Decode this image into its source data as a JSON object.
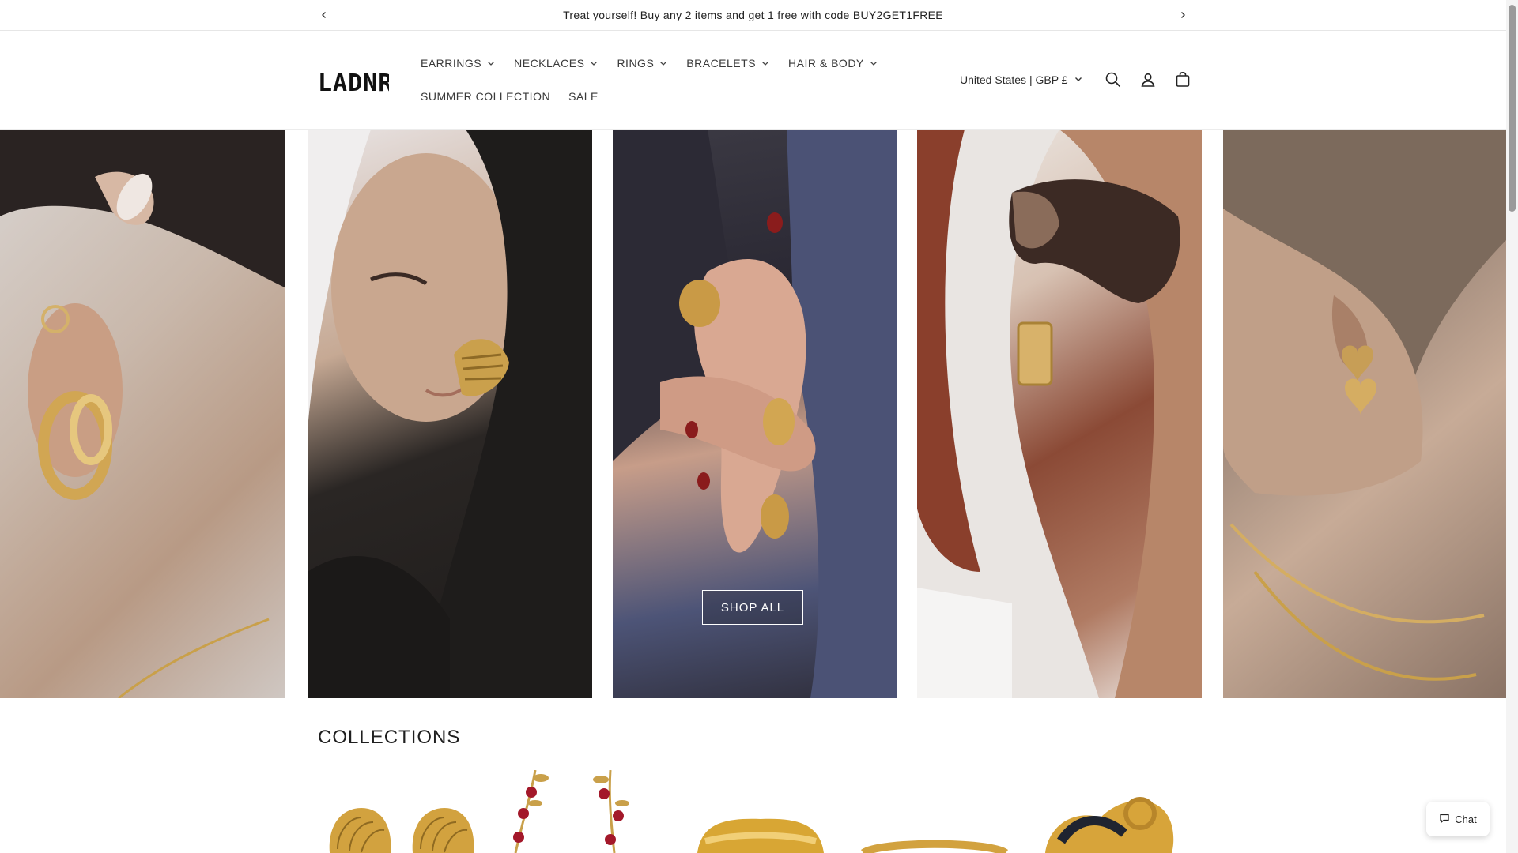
{
  "announcement": {
    "text": "Treat yourself! Buy any 2 items and get 1 free with code BUY2GET1FREE"
  },
  "header": {
    "logo_text": "LADNR",
    "nav_row1": [
      {
        "label": "EARRINGS",
        "has_dropdown": true
      },
      {
        "label": "NECKLACES",
        "has_dropdown": true
      },
      {
        "label": "RINGS",
        "has_dropdown": true
      },
      {
        "label": "BRACELETS",
        "has_dropdown": true
      },
      {
        "label": "HAIR & BODY",
        "has_dropdown": true
      }
    ],
    "nav_row2": [
      {
        "label": "SUMMER COLLECTION",
        "has_dropdown": false
      },
      {
        "label": "SALE",
        "has_dropdown": false
      }
    ],
    "country_selector": "United States | GBP £",
    "icons": [
      "search-icon",
      "account-icon",
      "cart-icon"
    ]
  },
  "hero": {
    "cta_label": "SHOP ALL"
  },
  "collections": {
    "title": "COLLECTIONS"
  },
  "chat": {
    "label": "Chat"
  },
  "colors": {
    "text": "#1f1f1f",
    "gold": "#c9a04a",
    "cherry": "#a3182a"
  }
}
